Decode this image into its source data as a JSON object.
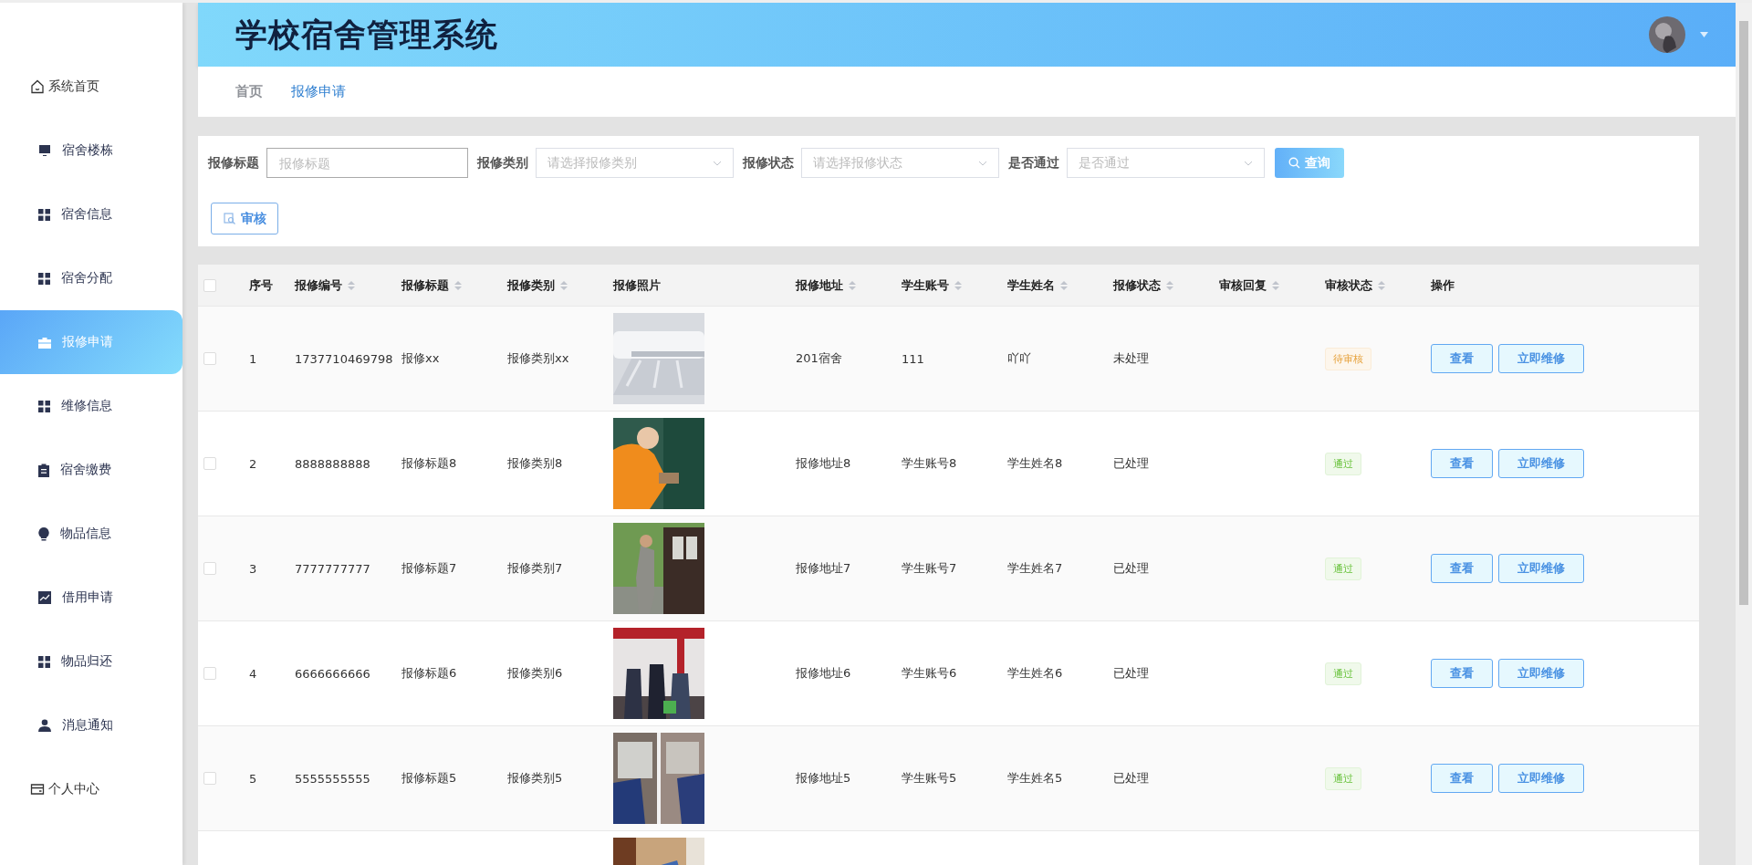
{
  "sidebar": {
    "items": [
      {
        "label": "系统首页",
        "kind": "top",
        "selected": false
      },
      {
        "label": "宿舍楼栋",
        "kind": "menu",
        "selected": false
      },
      {
        "label": "宿舍信息",
        "kind": "menu",
        "selected": false
      },
      {
        "label": "宿舍分配",
        "kind": "menu",
        "selected": false
      },
      {
        "label": "报修申请",
        "kind": "menu",
        "selected": true
      },
      {
        "label": "维修信息",
        "kind": "menu",
        "selected": false
      },
      {
        "label": "宿舍缴费",
        "kind": "menu",
        "selected": false
      },
      {
        "label": "物品信息",
        "kind": "menu",
        "selected": false
      },
      {
        "label": "借用申请",
        "kind": "menu",
        "selected": false
      },
      {
        "label": "物品归还",
        "kind": "menu",
        "selected": false
      },
      {
        "label": "消息通知",
        "kind": "menu",
        "selected": false
      },
      {
        "label": "个人中心",
        "kind": "top",
        "selected": false
      }
    ]
  },
  "header": {
    "title": "学校宿舍管理系统"
  },
  "breadcrumb": [
    {
      "label": "首页",
      "selected": false
    },
    {
      "label": "报修申请",
      "selected": true
    }
  ],
  "filters": [
    {
      "label": "报修标题",
      "kind": "input",
      "placeholder": "报修标题"
    },
    {
      "label": "报修类别",
      "kind": "select",
      "placeholder": "请选择报修类别"
    },
    {
      "label": "报修状态",
      "kind": "select",
      "placeholder": "请选择报修状态"
    },
    {
      "label": "是否通过",
      "kind": "select",
      "placeholder": "是否通过"
    }
  ],
  "search_button": "查询",
  "audit_button": "审核",
  "table": {
    "columns": [
      {
        "label": "序号",
        "kind": "plain"
      },
      {
        "label": "报修编号",
        "kind": "sortable"
      },
      {
        "label": "报修标题",
        "kind": "sortable"
      },
      {
        "label": "报修类别",
        "kind": "sortable"
      },
      {
        "label": "报修照片",
        "kind": "plain"
      },
      {
        "label": "报修地址",
        "kind": "sortable"
      },
      {
        "label": "学生账号",
        "kind": "sortable"
      },
      {
        "label": "学生姓名",
        "kind": "sortable"
      },
      {
        "label": "报修状态",
        "kind": "sortable"
      },
      {
        "label": "审核回复",
        "kind": "sortable"
      },
      {
        "label": "审核状态",
        "kind": "sortable"
      },
      {
        "label": "操作",
        "kind": "plain"
      }
    ],
    "select_all_checked": false,
    "rows": [
      {
        "checked": false,
        "index": "1",
        "number": "1737710469798",
        "title": "报修xx",
        "category": "报修类别xx",
        "photo": {
          "kind": "picture"
        },
        "address": "201宿舍",
        "account": "111",
        "name": "吖吖",
        "repair_status": "未处理",
        "audit": {
          "text": "待审核",
          "kind": "pending"
        },
        "actions": [
          "查看",
          "立即维修"
        ]
      },
      {
        "checked": false,
        "index": "2",
        "number": "8888888888",
        "title": "报修标题8",
        "category": "报修类别8",
        "photo": {
          "kind": "picture"
        },
        "address": "报修地址8",
        "account": "学生账号8",
        "name": "学生姓名8",
        "repair_status": "已处理",
        "audit": {
          "text": "通过",
          "kind": "passed"
        },
        "actions": [
          "查看",
          "立即维修"
        ]
      },
      {
        "checked": false,
        "index": "3",
        "number": "7777777777",
        "title": "报修标题7",
        "category": "报修类别7",
        "photo": {
          "kind": "picture"
        },
        "address": "报修地址7",
        "account": "学生账号7",
        "name": "学生姓名7",
        "repair_status": "已处理",
        "audit": {
          "text": "通过",
          "kind": "passed"
        },
        "actions": [
          "查看",
          "立即维修"
        ]
      },
      {
        "checked": false,
        "index": "4",
        "number": "6666666666",
        "title": "报修标题6",
        "category": "报修类别6",
        "photo": {
          "kind": "picture"
        },
        "address": "报修地址6",
        "account": "学生账号6",
        "name": "学生姓名6",
        "repair_status": "已处理",
        "audit": {
          "text": "通过",
          "kind": "passed"
        },
        "actions": [
          "查看",
          "立即维修"
        ]
      },
      {
        "checked": false,
        "index": "5",
        "number": "5555555555",
        "title": "报修标题5",
        "category": "报修类别5",
        "photo": {
          "kind": "picture"
        },
        "address": "报修地址5",
        "account": "学生账号5",
        "name": "学生姓名5",
        "repair_status": "已处理",
        "audit": {
          "text": "通过",
          "kind": "passed"
        },
        "actions": [
          "查看",
          "立即维修"
        ]
      },
      {
        "photo": {
          "kind": "picture"
        }
      }
    ]
  }
}
